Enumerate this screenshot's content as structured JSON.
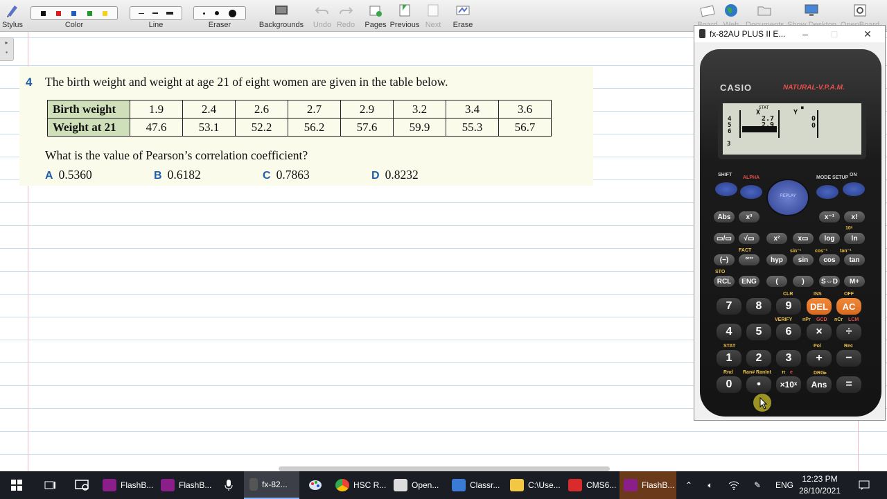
{
  "toolbar": {
    "stylus": "Stylus",
    "color": "Color",
    "color_swatches": [
      "#111111",
      "#e01b1b",
      "#1c5fc4",
      "#1f9a2a",
      "#f2d21a"
    ],
    "line": "Line",
    "eraser": "Eraser",
    "backgrounds": "Backgrounds",
    "undo": "Undo",
    "redo": "Redo",
    "pages": "Pages",
    "previous": "Previous",
    "next": "Next",
    "erase": "Erase",
    "board": "Board",
    "web": "Web",
    "documents": "Documents",
    "show_desktop": "Show Desktop",
    "openboard": "OpenBoard"
  },
  "question": {
    "number": "4",
    "text": "The birth weight and weight at age 21 of eight women are given in the table below.",
    "table": {
      "row1_label": "Birth weight",
      "row1": [
        "1.9",
        "2.4",
        "2.6",
        "2.7",
        "2.9",
        "3.2",
        "3.4",
        "3.6"
      ],
      "row2_label": "Weight at 21",
      "row2": [
        "47.6",
        "53.1",
        "52.2",
        "56.2",
        "57.6",
        "59.9",
        "55.3",
        "56.7"
      ]
    },
    "prompt": "What is the value of Pearson’s correlation coefficient?",
    "options": [
      {
        "letter": "A",
        "value": "0.5360"
      },
      {
        "letter": "B",
        "value": "0.6182"
      },
      {
        "letter": "C",
        "value": "0.7863"
      },
      {
        "letter": "D",
        "value": "0.8232"
      }
    ]
  },
  "calculator": {
    "window_title": "fx-82AU PLUS II E...",
    "brand": "CASIO",
    "model_line": "NATURAL-V.P.A.M.",
    "lcd": {
      "indicators": [
        "STAT",
        "■"
      ],
      "col_x": "X",
      "col_y": "Y",
      "rows": [
        "4",
        "5",
        "6"
      ],
      "x_vals": [
        "2.7",
        "2.9"
      ],
      "y_vals": [
        "0",
        "0"
      ],
      "cursor_row": "3"
    },
    "keys": {
      "shift": "SHIFT",
      "alpha": "ALPHA",
      "mode": "MODE SETUP",
      "on": "ON",
      "replay": "REPLAY",
      "abs": "Abs",
      "x3": "x³",
      "xinv": "x⁻¹",
      "xfact": "x!",
      "frac": "▭/▭",
      "sqrt": "√▭",
      "x2": "x²",
      "xpow": "x▭",
      "log": "log",
      "ln": "ln",
      "neg": "(−)",
      "deg": "°'''",
      "hyp": "hyp",
      "sin": "sin",
      "cos": "cos",
      "tan": "tan",
      "rcl": "RCL",
      "eng": "ENG",
      "lparen": "(",
      "rparen": ")",
      "sd": "S⇔D",
      "mplus": "M+",
      "n7": "7",
      "n8": "8",
      "n9": "9",
      "del": "DEL",
      "ac": "AC",
      "n4": "4",
      "n5": "5",
      "n6": "6",
      "mul": "×",
      "div": "÷",
      "n1": "1",
      "n2": "2",
      "n3": "3",
      "add": "+",
      "sub": "−",
      "n0": "0",
      "dot": "•",
      "x10": "×10ˣ",
      "ans": "Ans",
      "eq": "=",
      "sub_clr": "CLR",
      "sub_ins": "INS",
      "sub_off": "OFF",
      "sub_verify": "VERIFY",
      "sub_npr": "nPr",
      "sub_gcd": "GCD",
      "sub_ncr": "nCr",
      "sub_lcm": "LCM",
      "sub_stat": "STAT",
      "sub_pol": "Pol",
      "sub_rec": "Rec",
      "sub_rnd": "Rnd",
      "sub_ran": "Ran# RanInt",
      "sub_pi": "π",
      "sub_e": "e",
      "sub_drg": "DRG▸",
      "sub_sto": "STO",
      "sub_fact": "FACT",
      "sub_sin1": "sin⁻¹",
      "sub_cos1": "cos⁻¹",
      "sub_tan1": "tan⁻¹",
      "sub_10x": "10ˣ",
      "sub_ex": "eˣ"
    }
  },
  "taskbar": {
    "apps": [
      {
        "label": "FlashB...",
        "color": "#8a1f8a"
      },
      {
        "label": "FlashB...",
        "color": "#8a1f8a"
      },
      {
        "label": "fx-82...",
        "color": "#555555"
      },
      {
        "label": "HSC R...",
        "color": "#4285f4"
      },
      {
        "label": "Open...",
        "color": "#dddddd"
      },
      {
        "label": "Classr...",
        "color": "#3a7bd5"
      },
      {
        "label": "C:\\Use...",
        "color": "#f2c744"
      },
      {
        "label": "CMS6...",
        "color": "#d92b2b"
      },
      {
        "label": "FlashB...",
        "color": "#8a1f8a"
      }
    ],
    "language": "ENG",
    "time": "12:23 PM",
    "date": "28/10/2021"
  }
}
